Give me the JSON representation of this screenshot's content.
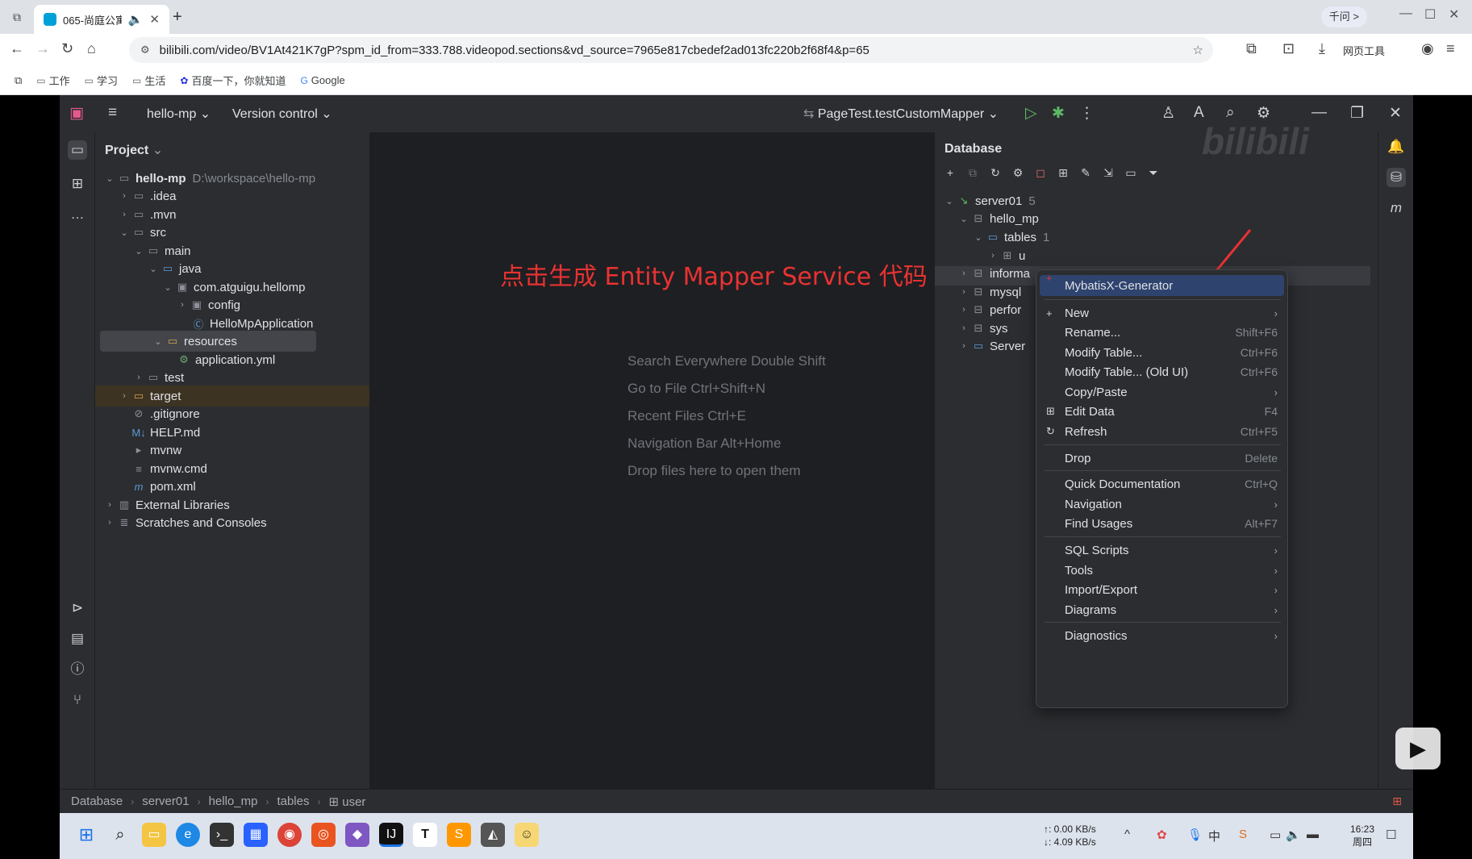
{
  "browser": {
    "tab_title": "065-尚庭公寓",
    "qianwen_label": "千问 >",
    "url": "bilibili.com/video/BV1At421K7gP?spm_id_from=333.788.videopod.sections&vd_source=7965e817cbedef2ad013fc220b2f68f4&p=65",
    "web_tools_label": "网页工具",
    "bookmarks": [
      "工作",
      "学习",
      "生活",
      "百度一下，你就知道",
      "Google"
    ]
  },
  "ide": {
    "project_name": "hello-mp",
    "version_control": "Version control",
    "run_config": "PageTest.testCustomMapper",
    "project_panel_title": "Project",
    "database_panel_title": "Database",
    "project_tree": [
      {
        "label": "hello-mp",
        "extra": "D:\\workspace\\hello-mp"
      },
      {
        "label": ".idea"
      },
      {
        "label": ".mvn"
      },
      {
        "label": "src"
      },
      {
        "label": "main"
      },
      {
        "label": "java"
      },
      {
        "label": "com.atguigu.hellomp"
      },
      {
        "label": "config"
      },
      {
        "label": "HelloMpApplication"
      },
      {
        "label": "resources"
      },
      {
        "label": "application.yml"
      },
      {
        "label": "test"
      },
      {
        "label": "target"
      },
      {
        "label": ".gitignore"
      },
      {
        "label": "HELP.md"
      },
      {
        "label": "mvnw"
      },
      {
        "label": "mvnw.cmd"
      },
      {
        "label": "pom.xml"
      },
      {
        "label": "External Libraries"
      },
      {
        "label": "Scratches and Consoles"
      }
    ],
    "editor_hints": [
      "Search Everywhere Double Shift",
      "Go to File Ctrl+Shift+N",
      "Recent Files Ctrl+E",
      "Navigation Bar Alt+Home",
      "Drop files here to open them"
    ],
    "annotation": "点击生成 Entity Mapper Service 代码",
    "db_tree": [
      {
        "label": "server01",
        "count": "5"
      },
      {
        "label": "hello_mp"
      },
      {
        "label": "tables",
        "count": "1"
      },
      {
        "label": "u"
      },
      {
        "label": "informa"
      },
      {
        "label": "mysql"
      },
      {
        "label": "perfor"
      },
      {
        "label": "sys"
      },
      {
        "label": "Server"
      }
    ],
    "context_menu": [
      {
        "label": "MybatisX-Generator",
        "shortcut": ""
      },
      {
        "label": "New",
        "shortcut": ""
      },
      {
        "label": "Rename...",
        "shortcut": "Shift+F6"
      },
      {
        "label": "Modify Table...",
        "shortcut": "Ctrl+F6"
      },
      {
        "label": "Modify Table... (Old UI)",
        "shortcut": "Ctrl+F6"
      },
      {
        "label": "Copy/Paste",
        "shortcut": ""
      },
      {
        "label": "Edit Data",
        "shortcut": "F4"
      },
      {
        "label": "Refresh",
        "shortcut": "Ctrl+F5"
      },
      {
        "label": "Drop",
        "shortcut": "Delete"
      },
      {
        "label": "Quick Documentation",
        "shortcut": "Ctrl+Q"
      },
      {
        "label": "Navigation",
        "shortcut": ""
      },
      {
        "label": "Find Usages",
        "shortcut": "Alt+F7"
      },
      {
        "label": "SQL Scripts",
        "shortcut": ""
      },
      {
        "label": "Tools",
        "shortcut": ""
      },
      {
        "label": "Import/Export",
        "shortcut": ""
      },
      {
        "label": "Diagrams",
        "shortcut": ""
      },
      {
        "label": "Diagnostics",
        "shortcut": ""
      }
    ],
    "breadcrumb": [
      "Database",
      "server01",
      "hello_mp",
      "tables",
      "user"
    ]
  },
  "taskbar": {
    "net_up": "↑: 0.00 KB/s",
    "net_down": "↓: 4.09 KB/s",
    "time": "16:23",
    "weekday": "周四"
  },
  "colors": {
    "ide_bg": "#1e1f22",
    "panel_bg": "#2b2d30",
    "menu_highlight": "#2e436e",
    "annotation_red": "#e93232"
  }
}
